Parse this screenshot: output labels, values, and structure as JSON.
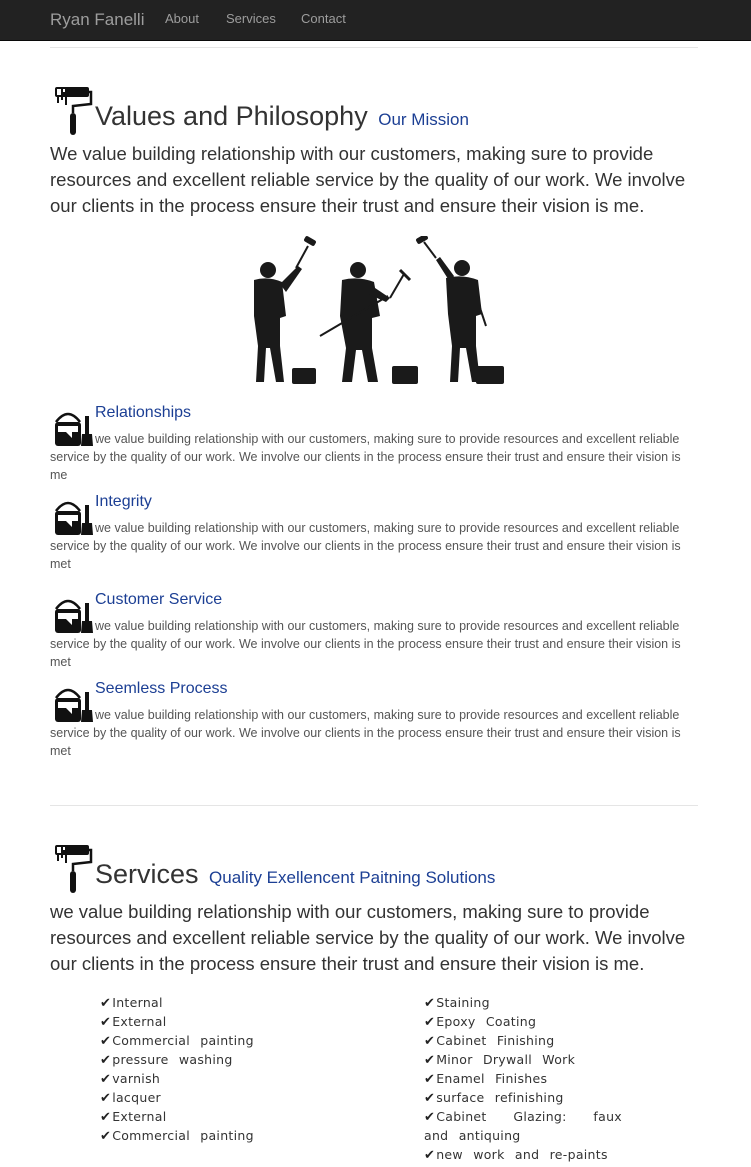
{
  "navbar": {
    "brand": "Ryan Fanelli",
    "links": [
      "About",
      "Services",
      "Contact"
    ]
  },
  "values_section": {
    "title": "Values and Philosophy",
    "subtitle": "Our Mission",
    "lead": "We value building relationship with our customers, making sure to provide resources and excellent reliable service by the quality of our work. We involve our clients in the process ensure their trust and ensure their vision is me.",
    "items": [
      {
        "title": "Relationships",
        "text": "we value building relationship with our customers, making sure to provide resources and excellent reliable service by the quality of our work. We involve our clients in the process ensure their trust and ensure their vision is me"
      },
      {
        "title": "Integrity",
        "text": "we value building relationship with our customers, making sure to provide resources and excellent reliable service by the quality of our work. We involve our clients in the process ensure their trust and ensure their vision is met"
      },
      {
        "title": "Customer Service",
        "text": "we value building relationship with our customers, making sure to provide resources and excellent reliable service by the quality of our work. We involve our clients in the process ensure their trust and ensure their vision is met"
      },
      {
        "title": "Seemless Process",
        "text": "we value building relationship with our customers, making sure to provide resources and excellent reliable service by the quality of our work. We involve our clients in the process ensure their trust and ensure their vision is met"
      }
    ]
  },
  "services_section": {
    "title": "Services",
    "subtitle": "Quality Exellencent Paitning Solutions",
    "lead": "we value building relationship with our customers, making sure to provide resources and excellent reliable service by the quality of our work. We involve our clients in the process ensure their trust and ensure their vision is me.",
    "left_list": [
      "Internal",
      "External",
      "Commercial painting",
      "pressure washing",
      "varnish",
      "lacquer",
      "External",
      "Commercial painting"
    ],
    "right_list": [
      "Staining",
      "Epoxy Coating",
      "Cabinet Finishing",
      "Minor Drywall Work",
      "Enamel Finishes",
      "surface refinishing",
      "Cabinet Glazing: faux and antiquing",
      "new work and re-paints"
    ]
  },
  "icons": {
    "section": "paint-roller-icon",
    "item": "paint-bucket-brush-icon",
    "list": "checkmark-icon"
  },
  "colors": {
    "navbar_bg": "#222222",
    "nav_text": "#9d9d9d",
    "accent_blue": "#1c3f94"
  }
}
